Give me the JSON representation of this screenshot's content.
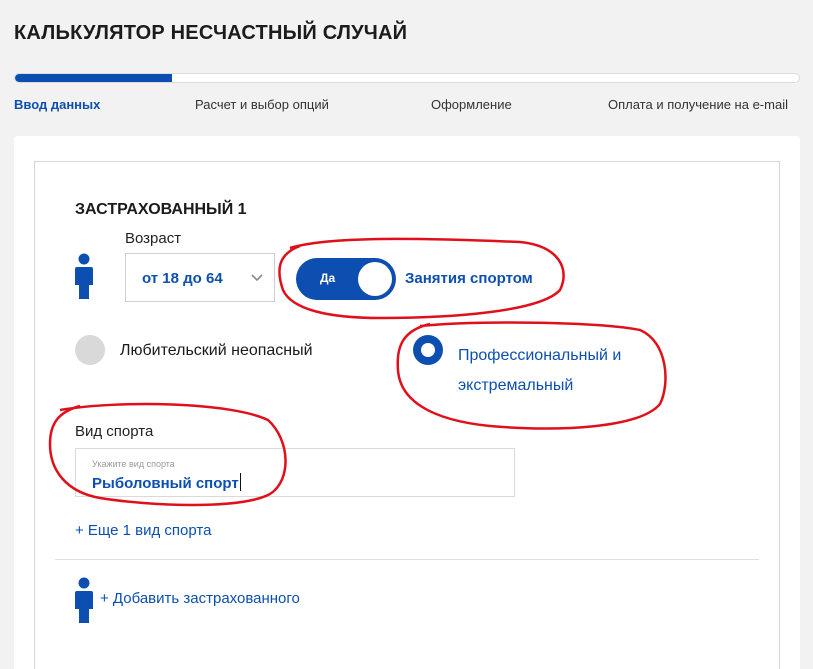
{
  "page": {
    "title": "КАЛЬКУЛЯТОР НЕСЧАСТНЫЙ СЛУЧАЙ"
  },
  "progress": {
    "fraction": 0.2
  },
  "steps": [
    {
      "label": "Ввод данных",
      "active": true
    },
    {
      "label": "Расчет и выбор опций",
      "active": false
    },
    {
      "label": "Оформление",
      "active": false
    },
    {
      "label": "Оплата и получение на e-mail",
      "active": false
    }
  ],
  "insured": {
    "title": "ЗАСТРАХОВАННЫЙ 1",
    "age_label": "Возраст",
    "age_value": "от 18 до 64",
    "sport_toggle": {
      "state_label": "Да",
      "label": "Занятия спортом",
      "on": true
    },
    "radio_amateur": {
      "label": "Любительский неопасный",
      "selected": false
    },
    "radio_pro": {
      "label": "Профессиональный и экстремальный",
      "selected": true
    },
    "sport_field": {
      "label": "Вид спорта",
      "placeholder": "Укажите вид спорта",
      "value": "Рыболовный спорт"
    },
    "add_sport_link": "+ Еще 1 вид спорта"
  },
  "add_insured_link": "+ Добавить застрахованного",
  "colors": {
    "accent": "#0d4fb0",
    "annotation": "#e0101a",
    "background": "#f2f2f2"
  },
  "icons": {
    "person": "person-icon",
    "chevron": "chevron-down-icon"
  }
}
